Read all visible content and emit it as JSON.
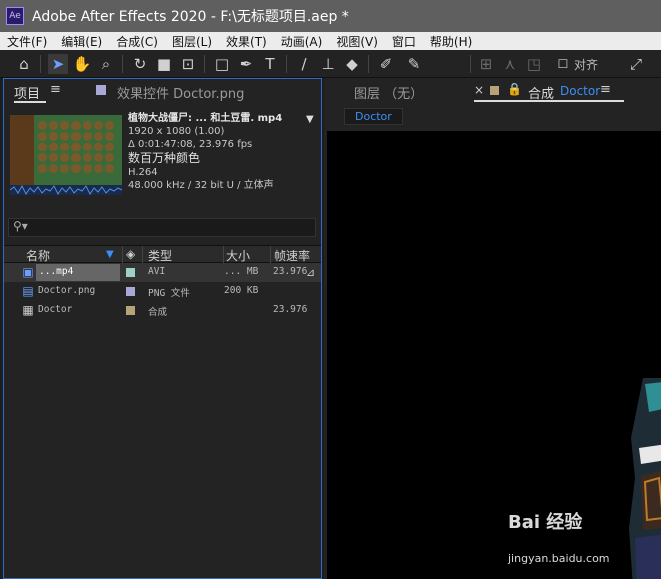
{
  "window": {
    "title": "Adobe After Effects 2020 - F:\\无标题项目.aep *",
    "logo": "Ae"
  },
  "menu": [
    "文件(F)",
    "编辑(E)",
    "合成(C)",
    "图层(L)",
    "效果(T)",
    "动画(A)",
    "视图(V)",
    "窗口",
    "帮助(H)"
  ],
  "toolbar": {
    "align_label": "对齐"
  },
  "project_panel": {
    "tab_label": "项目",
    "effects_tab_label": "效果控件 Doctor.png",
    "preview": {
      "filename": "植物大战僵尸: ... 和土豆雷. mp4",
      "resolution": "1920 x 1080 (1.00)",
      "duration": "Δ 0:01:47:08, 23.976 fps",
      "colors": "数百万种颜色",
      "codec": "H.264",
      "audio": "48.000 kHz / 32 bit U / 立体声"
    },
    "columns": {
      "name": "名称",
      "type": "类型",
      "size": "大小",
      "framerate": "帧速率"
    },
    "items": [
      {
        "name": "...mp4",
        "label_color": "#9ed0c8",
        "type": "AVI",
        "size": "... MB",
        "fps": "23.976",
        "icon": "video-icon",
        "selected": true
      },
      {
        "name": "Doctor.png",
        "label_color": "#a9a6d8",
        "type": "PNG 文件",
        "size": "200 KB",
        "fps": "",
        "icon": "image-icon",
        "selected": false
      },
      {
        "name": "Doctor",
        "label_color": "#b7a27a",
        "type": "合成",
        "size": "",
        "fps": "23.976",
        "icon": "composition-icon",
        "selected": false
      }
    ]
  },
  "layer_tab": {
    "label": "图层 （无）"
  },
  "comp_tab": {
    "label": "合成",
    "name": "Doctor",
    "sub_label": "Doctor"
  },
  "watermark": {
    "brand": "Bai 经验",
    "url": "jingyan.baidu.com"
  }
}
